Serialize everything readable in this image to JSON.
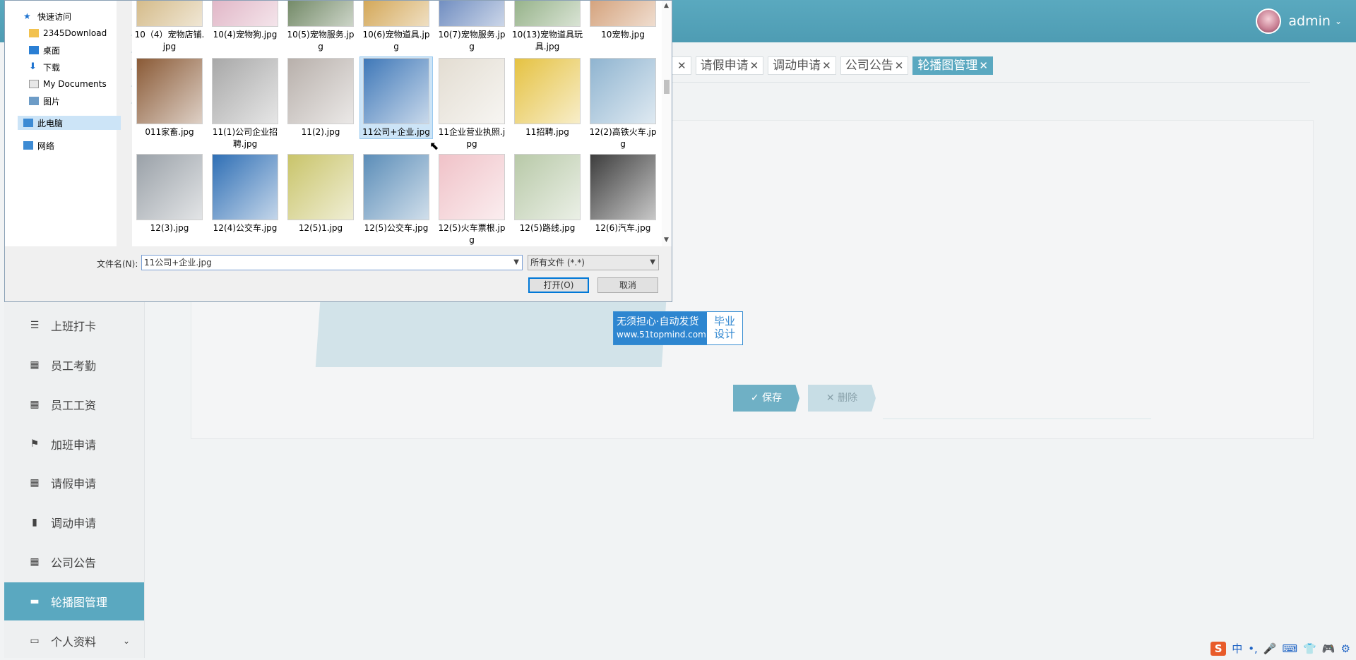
{
  "header": {
    "user": "admin"
  },
  "tabs": [
    "请假申请",
    "调动申请",
    "公司公告",
    "轮播图管理"
  ],
  "sidebar": {
    "items": [
      {
        "label": "上班打卡",
        "icon": "list-icon"
      },
      {
        "label": "员工考勤",
        "icon": "grid-icon"
      },
      {
        "label": "员工工资",
        "icon": "grid-icon"
      },
      {
        "label": "加班申请",
        "icon": "flag-icon"
      },
      {
        "label": "请假申请",
        "icon": "grid-icon"
      },
      {
        "label": "调动申请",
        "icon": "bar-chart-icon"
      },
      {
        "label": "公司公告",
        "icon": "grid-icon"
      },
      {
        "label": "轮播图管理",
        "icon": "ticket-icon"
      },
      {
        "label": "个人资料",
        "icon": "card-icon"
      }
    ]
  },
  "form": {
    "save": "保存",
    "delete": "删除"
  },
  "watermark": {
    "line1": "无须担心·自动发货",
    "url": "www.51topmind.com",
    "right1": "毕业",
    "right2": "设计"
  },
  "dialog": {
    "nav": [
      {
        "label": "快速访问",
        "icon": "star-icon"
      },
      {
        "label": "2345Download",
        "icon": "folder-icon",
        "pinned": true
      },
      {
        "label": "桌面",
        "icon": "desktop-icon",
        "pinned": true
      },
      {
        "label": "下载",
        "icon": "download-icon",
        "pinned": true
      },
      {
        "label": "My Documents",
        "icon": "document-icon",
        "pinned": true
      },
      {
        "label": "图片",
        "icon": "picture-icon",
        "pinned": true
      },
      {
        "label": "此电脑",
        "icon": "computer-icon"
      },
      {
        "label": "网络",
        "icon": "network-icon"
      }
    ],
    "files": [
      {
        "name": "10（4）宠物店铺.jpg",
        "color": "#c9a96a"
      },
      {
        "name": "10(4)宠物狗.jpg",
        "color": "#d9a3b8"
      },
      {
        "name": "10(5)宠物服务.jpg",
        "color": "#4d6a3e"
      },
      {
        "name": "10(6)宠物道具.jpg",
        "color": "#c8902b"
      },
      {
        "name": "10(7)宠物服务.jpg",
        "color": "#4a6fb0"
      },
      {
        "name": "10(13)宠物道具玩具.jpg",
        "color": "#7a9e6a"
      },
      {
        "name": "10宠物.jpg",
        "color": "#c98a5a"
      },
      {
        "name": "011家畜.jpg",
        "color": "#8a5a36"
      },
      {
        "name": "11(1)公司企业招聘.jpg",
        "color": "#a8a8a8"
      },
      {
        "name": "11(2).jpg",
        "color": "#b8b0ab"
      },
      {
        "name": "11公司+企业.jpg",
        "color": "#3f78b8"
      },
      {
        "name": "11企业营业执照.jpg",
        "color": "#e3ddd2"
      },
      {
        "name": "11招聘.jpg",
        "color": "#e5c242"
      },
      {
        "name": "12(2)高铁火车.jpg",
        "color": "#8fb4d0"
      },
      {
        "name": "12(3).jpg",
        "color": "#9aa1a8"
      },
      {
        "name": "12(4)公交车.jpg",
        "color": "#2f6fb5"
      },
      {
        "name": "12(5)1.jpg",
        "color": "#c9c46a"
      },
      {
        "name": "12(5)公交车.jpg",
        "color": "#5b8db8"
      },
      {
        "name": "12(5)火车票根.jpg",
        "color": "#f0c2c8"
      },
      {
        "name": "12(5)路线.jpg",
        "color": "#b8c9a8"
      },
      {
        "name": "12(6)汽车.jpg",
        "color": "#3d3d3d"
      }
    ],
    "filename_label": "文件名(N):",
    "filename_value": "11公司+企业.jpg",
    "filetype": "所有文件 (*.*)",
    "open": "打开(O)",
    "cancel": "取消"
  },
  "tray": [
    "中",
    "•,",
    "🎤",
    "⌨",
    "👕",
    "🎮",
    "⚙"
  ]
}
